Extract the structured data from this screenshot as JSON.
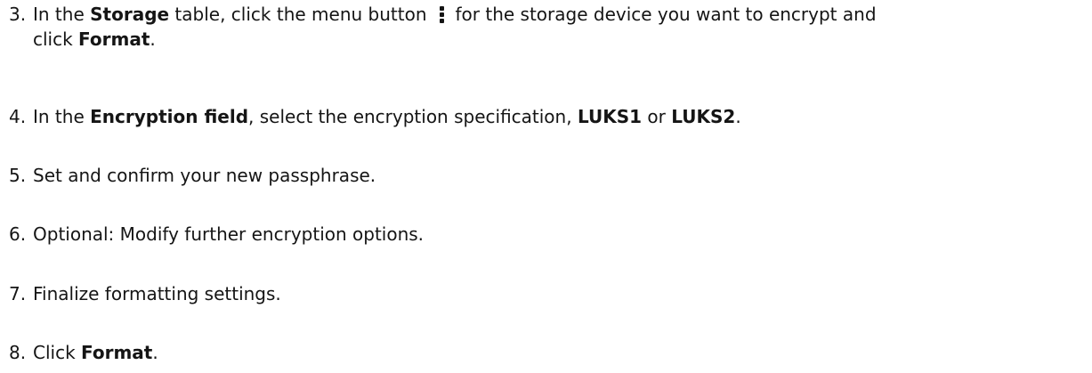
{
  "steps": [
    {
      "number": "3.",
      "line1_before": "In the ",
      "storage": "Storage",
      "line1_middle": " table, click the menu button",
      "line1_after": "for the storage device you want to encrypt and",
      "line2_before": "click ",
      "format": "Format",
      "line2_after": "."
    },
    {
      "number": "4.",
      "before": "In the ",
      "encryption_field": "Encryption field",
      "middle": ", select the encryption specification, ",
      "luks1": "LUKS1",
      "or": " or ",
      "luks2": "LUKS2",
      "after": "."
    },
    {
      "number": "5.",
      "text": "Set and confirm your new passphrase."
    },
    {
      "number": "6.",
      "text": "Optional: Modify further encryption options."
    },
    {
      "number": "7.",
      "text": "Finalize formatting settings."
    },
    {
      "number": "8.",
      "before": "Click ",
      "format": "Format",
      "after": "."
    }
  ],
  "icons": {
    "menu_button": "kebab-icon"
  }
}
